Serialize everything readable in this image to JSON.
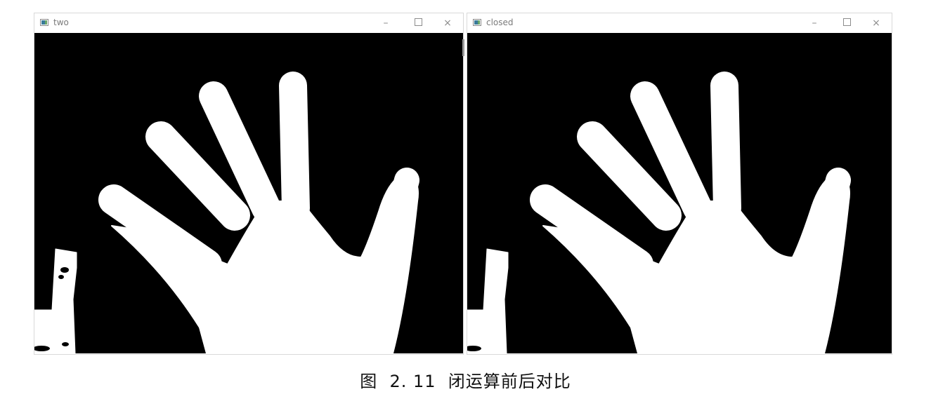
{
  "windows": [
    {
      "title": "two",
      "controls": {
        "minimize": "–",
        "maximize": "",
        "close": "×"
      }
    },
    {
      "title": "closed",
      "controls": {
        "minimize": "–",
        "maximize": "",
        "close": "×"
      }
    }
  ],
  "caption": {
    "label": "图  2. 11  闭运算前后对比"
  },
  "colors": {
    "background": "#000000",
    "foreground": "#ffffff"
  }
}
